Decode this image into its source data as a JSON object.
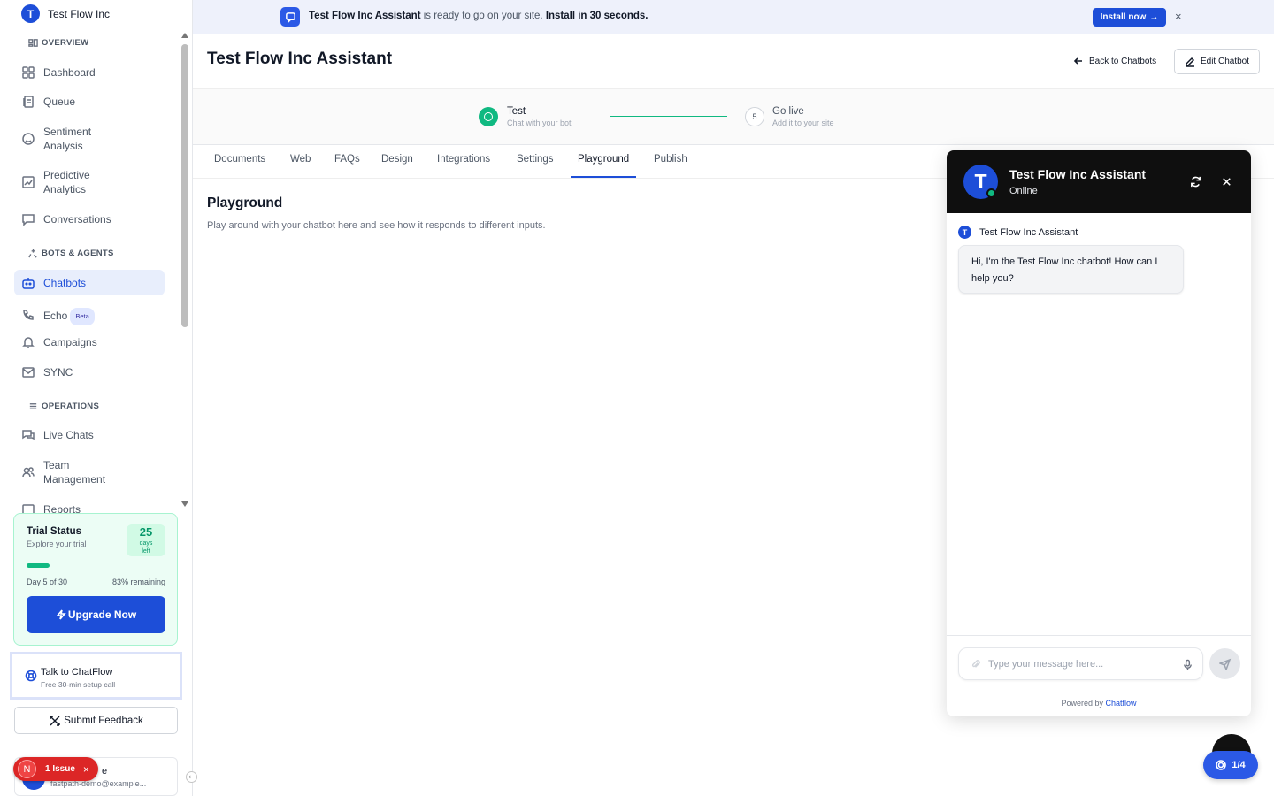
{
  "org": {
    "initial": "T",
    "name": "Test Flow Inc"
  },
  "sidebar": {
    "sections": {
      "overview": "OVERVIEW",
      "bots": "BOTS & AGENTS",
      "operations": "OPERATIONS"
    },
    "items": {
      "dashboard": "Dashboard",
      "queue": "Queue",
      "sentiment_line1": "Sentiment",
      "sentiment_line2": "Analysis",
      "predictive_line1": "Predictive",
      "predictive_line2": "Analytics",
      "conversations": "Conversations",
      "chatbots": "Chatbots",
      "echo": "Echo",
      "echo_badge": "Beta",
      "campaigns": "Campaigns",
      "sync": "SYNC",
      "live_chats": "Live Chats",
      "team_line1": "Team",
      "team_line2": "Management",
      "reports": "Reports"
    },
    "trial": {
      "title": "Trial Status",
      "subtitle": "Explore your trial",
      "days_left_num": "25",
      "days_label1": "days",
      "days_label2": "left",
      "progress_fraction": 0.167,
      "day_text": "Day 5 of 30",
      "remaining_text": "83% remaining",
      "upgrade_label": "Upgrade Now"
    },
    "talk": {
      "title": "Talk to ChatFlow",
      "subtitle": "Free 30-min setup call"
    },
    "feedback_label": "Submit Feedback",
    "user": {
      "name_visible": "e",
      "email": "fastpath-demo@example..."
    },
    "issue": {
      "initial": "N",
      "label": "1 Issue",
      "close": "×"
    }
  },
  "banner": {
    "bold_name": "Test Flow Inc Assistant",
    "middle_text": " is ready to go on your site. ",
    "bold_cta": "Install in 30 seconds.",
    "install_label": "Install now",
    "install_arrow": "→",
    "close": "×"
  },
  "header": {
    "title": "Test Flow Inc Assistant",
    "back_label": "Back to Chatbots",
    "edit_label": "Edit Chatbot"
  },
  "stepper": {
    "step1_title": "Test",
    "step1_sub": "Chat with your bot",
    "step2_num": "5",
    "step2_title": "Go live",
    "step2_sub": "Add it to your site"
  },
  "tabs": [
    "Documents",
    "Web",
    "FAQs",
    "Design",
    "Integrations",
    "Settings",
    "Playground",
    "Publish"
  ],
  "playground": {
    "title": "Playground",
    "description": "Play around with your chatbot here and see how it responds to different inputs."
  },
  "chat": {
    "avatar_initial": "T",
    "name": "Test Flow Inc Assistant",
    "status": "Online",
    "bot_label": "Test Flow Inc Assistant",
    "message": "Hi, I'm the Test Flow Inc chatbot! How can I help you?",
    "input_placeholder": "Type your message here...",
    "powered_prefix": "Powered by ",
    "powered_brand": "Chatflow"
  },
  "pager": {
    "label": "1/4"
  },
  "colors": {
    "accent": "#1d4ed8",
    "success": "#10b981",
    "danger": "#dc2626"
  }
}
